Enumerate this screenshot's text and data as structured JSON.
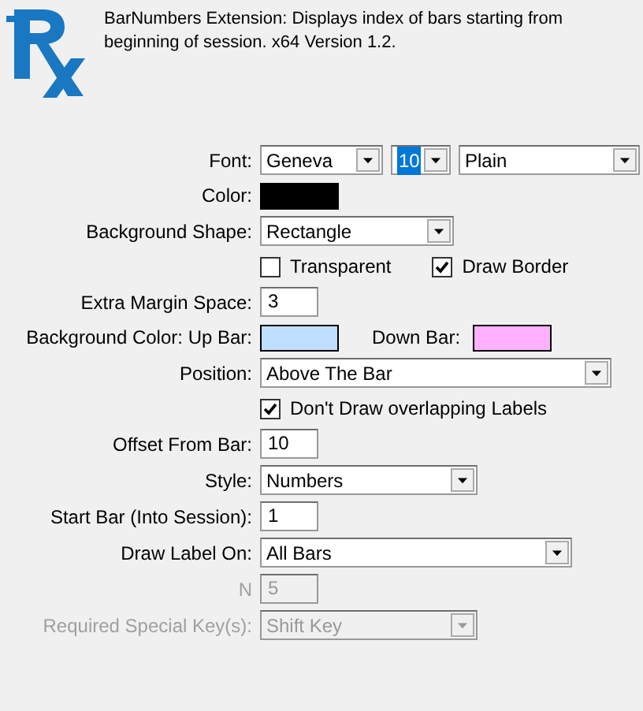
{
  "header": {
    "description": "BarNumbers Extension: Displays index of bars starting from beginning of session. x64 Version 1.2."
  },
  "rows": [
    {
      "kind": "selects",
      "label": "Font:",
      "disabled": false,
      "fields": [
        {
          "value": "Geneva",
          "text_selected": false
        },
        {
          "value": "10",
          "text_selected": true
        },
        {
          "value": "Plain",
          "text_selected": false
        }
      ]
    },
    {
      "kind": "color",
      "label": "Color:",
      "disabled": false,
      "color": "#000000"
    },
    {
      "kind": "select",
      "label": "Background Shape:",
      "disabled": false,
      "value": "Rectangle"
    },
    {
      "kind": "checks",
      "label": "",
      "disabled": false,
      "checks": [
        {
          "label": "Transparent",
          "checked": false
        },
        {
          "label": "Draw Border",
          "checked": true
        }
      ]
    },
    {
      "kind": "input",
      "label": "Extra Margin Space:",
      "disabled": false,
      "value": "3"
    },
    {
      "kind": "colors",
      "label": "Background Color: Up Bar:",
      "disabled": false,
      "swatches": [
        {
          "color": "#c0deff"
        },
        {
          "label": "Down Bar:",
          "color": "#ffb0ff"
        }
      ]
    },
    {
      "kind": "select",
      "label": "Position:",
      "disabled": false,
      "value": "Above The Bar"
    },
    {
      "kind": "checks",
      "label": "",
      "disabled": false,
      "checks": [
        {
          "label": "Don't Draw overlapping Labels",
          "checked": true
        }
      ]
    },
    {
      "kind": "input",
      "label": "Offset From Bar:",
      "disabled": false,
      "value": "10"
    },
    {
      "kind": "select",
      "label": "Style:",
      "disabled": false,
      "value": "Numbers"
    },
    {
      "kind": "input",
      "label": "Start Bar (Into Session):",
      "disabled": false,
      "value": "1"
    },
    {
      "kind": "select",
      "label": "Draw Label On:",
      "disabled": false,
      "value": "All Bars"
    },
    {
      "kind": "input",
      "label": "N",
      "disabled": true,
      "value": "5"
    },
    {
      "kind": "select",
      "label": "Required Special Key(s):",
      "disabled": true,
      "value": "Shift Key"
    }
  ]
}
